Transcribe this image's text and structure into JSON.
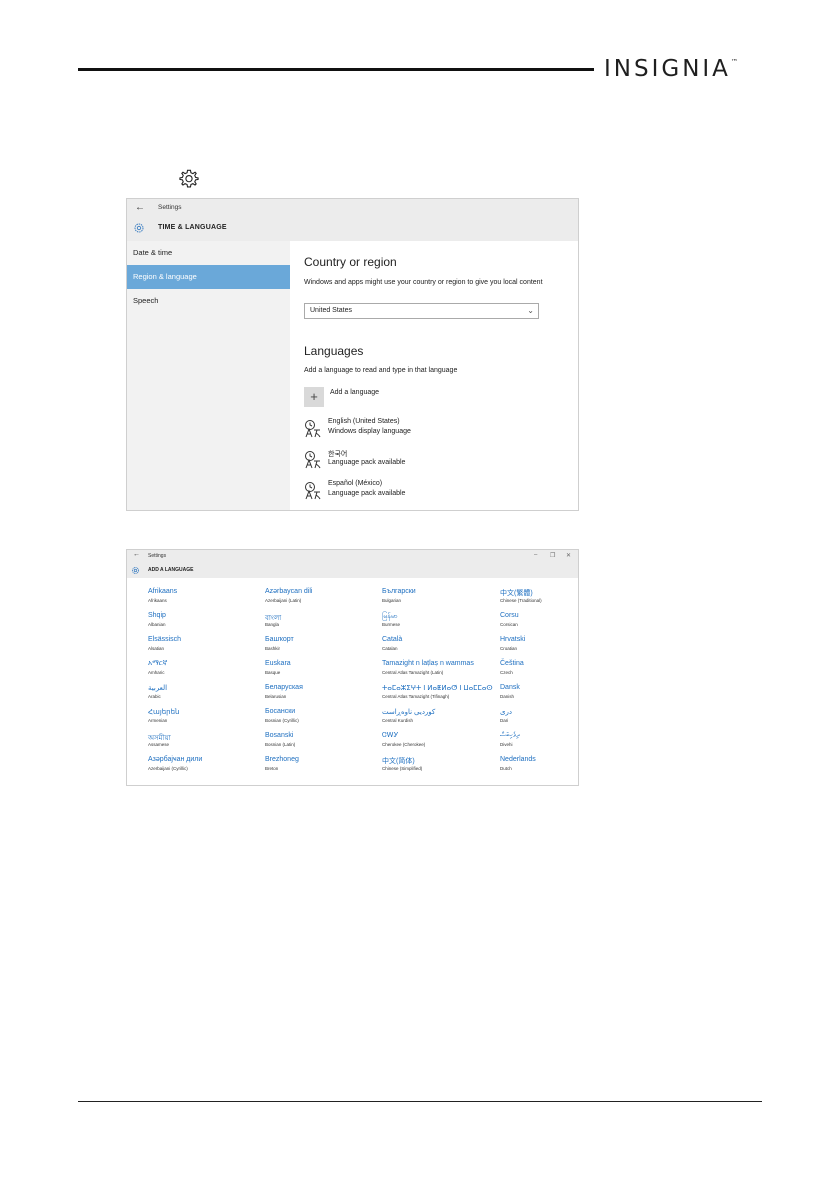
{
  "brand": {
    "name": "INSIGNIA",
    "mark": "™"
  },
  "step_icon": "gear-icon",
  "settings_window": {
    "window_title": "Settings",
    "back_icon": "back-arrow-icon",
    "section_icon": "gear-icon",
    "section_title": "TIME & LANGUAGE",
    "sidebar": [
      {
        "label": "Date & time",
        "selected": false
      },
      {
        "label": "Region & language",
        "selected": true
      },
      {
        "label": "Speech",
        "selected": false
      }
    ],
    "country": {
      "heading": "Country or region",
      "description": "Windows and apps might use your country or region to give you local content",
      "selected_value": "United States"
    },
    "languages": {
      "heading": "Languages",
      "description": "Add a language to read and type in that language",
      "add_label": "Add a language",
      "items": [
        {
          "name": "English (United States)",
          "status": "Windows display language"
        },
        {
          "name": "한국어",
          "status": "Language pack available"
        },
        {
          "name": "Español (México)",
          "status": "Language pack available"
        }
      ]
    },
    "accent_color": "#6aa8d9"
  },
  "add_language_window": {
    "window_title": "Settings",
    "section_title": "ADD A LANGUAGE",
    "window_controls": [
      "–",
      "❐",
      "✕"
    ],
    "link_color": "#1e6fc0",
    "columns": [
      [
        {
          "native": "Afrikaans",
          "english": "Afrikaans"
        },
        {
          "native": "Shqip",
          "english": "Albanian"
        },
        {
          "native": "Elsässisch",
          "english": "Alsatian"
        },
        {
          "native": "አማርኛ",
          "english": "Amharic"
        },
        {
          "native": "العربية",
          "english": "Arabic"
        },
        {
          "native": "Հայերեն",
          "english": "Armenian"
        },
        {
          "native": "অসমীয়া",
          "english": "Assamese"
        },
        {
          "native": "Азәрбајҹан дили",
          "english": "Azerbaijani (Cyrillic)"
        }
      ],
      [
        {
          "native": "Azərbaycan dili",
          "english": "Azerbaijani (Latin)"
        },
        {
          "native": "বাংলা",
          "english": "Bangla"
        },
        {
          "native": "Башҡорт",
          "english": "Bashkir"
        },
        {
          "native": "Euskara",
          "english": "Basque"
        },
        {
          "native": "Беларуская",
          "english": "Belarusian"
        },
        {
          "native": "Босански",
          "english": "Bosnian (Cyrillic)"
        },
        {
          "native": "Bosanski",
          "english": "Bosnian (Latin)"
        },
        {
          "native": "Brezhoneg",
          "english": "Breton"
        }
      ],
      [
        {
          "native": "Български",
          "english": "Bulgarian"
        },
        {
          "native": "မြန်မာ",
          "english": "Burmese"
        },
        {
          "native": "Català",
          "english": "Catalan"
        },
        {
          "native": "Tamazight n laṭlaṣ n wammas",
          "english": "Central Atlas Tamazight (Latin)"
        },
        {
          "native": "ⵜⴰⵎⴰⵣⵉⵖⵜ ⵏ ⵍⴰⵟⵍⴰⵚ ⵏ ⵡⴰⵎⵎⴰⵙ",
          "english": "Central Atlas Tamazight (Tifinagh)"
        },
        {
          "native": "کوردیی ناوەڕاست",
          "english": "Central Kurdish"
        },
        {
          "native": "ᏣᎳᎩ",
          "english": "Cherokee (Cherokee)"
        },
        {
          "native": "中文(简体)",
          "english": "Chinese (Simplified)"
        }
      ],
      [
        {
          "native": "中文(繁體)",
          "english": "Chinese (Traditional)"
        },
        {
          "native": "Corsu",
          "english": "Corsican"
        },
        {
          "native": "Hrvatski",
          "english": "Croatian"
        },
        {
          "native": "Čeština",
          "english": "Czech"
        },
        {
          "native": "Dansk",
          "english": "Danish"
        },
        {
          "native": "درى",
          "english": "Dari"
        },
        {
          "native": "ދިވެހިބަސް",
          "english": "Divehi"
        },
        {
          "native": "Nederlands",
          "english": "Dutch"
        }
      ]
    ]
  }
}
